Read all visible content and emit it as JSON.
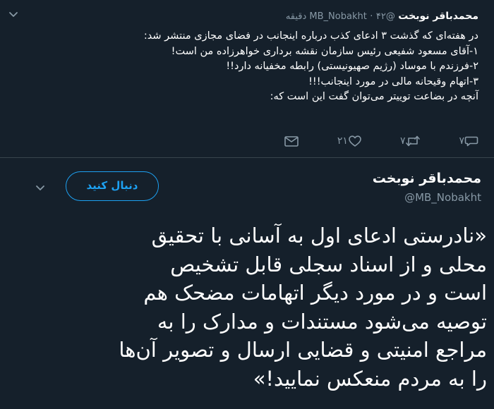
{
  "quoted_tweet": {
    "author_name": "محمدباقر نوبخت",
    "handle": "@MB_Nobakht",
    "separator": "·",
    "time": "۴۲ دقیقه",
    "lines": [
      "در هفته‌ای که گذشت ۳ ادعای کذب درباره اینجانب در فضای مجازی منتشر شد:",
      "۱-آقای مسعود شفیعی رئیس سازمان نقشه برداری خواهرزاده من است!",
      "۲-فرزندم با موساد (رژیم صهیونیستی) رابطه مخفیانه دارد!!",
      "۳-اتهام وقیحانه مالی در مورد اینجانب!!!",
      "آنچه در بضاعت توییتر می‌توان گفت این است که:"
    ],
    "actions": {
      "replies": "۷",
      "retweets": "۷",
      "likes": "۲۱"
    },
    "icons": {
      "reply": "reply-icon",
      "retweet": "retweet-icon",
      "like": "heart-icon",
      "message": "message-icon",
      "more": "chevron-down-icon"
    }
  },
  "main_tweet": {
    "author_name": "محمدباقر نوبخت",
    "handle": "@MB_Nobakht",
    "follow_label": "دنبال کنید",
    "lines": [
      "«نادرستی ادعای اول به آسانی با تحقیق",
      "محلی و از اسناد سجلی قابل تشخیص",
      "است و در مورد دیگر اتهامات مضحک هم",
      "توصیه می‌شود مستندات و مدارک را به",
      "مراجع امنیتی و قضایی ارسال و تصویر آن‌ها",
      "را به مردم منعکس نمایید!»"
    ]
  },
  "colors": {
    "background": "#15202b",
    "accent": "#1da1f2",
    "secondary_text": "#8899a6",
    "divider": "#38444d"
  }
}
